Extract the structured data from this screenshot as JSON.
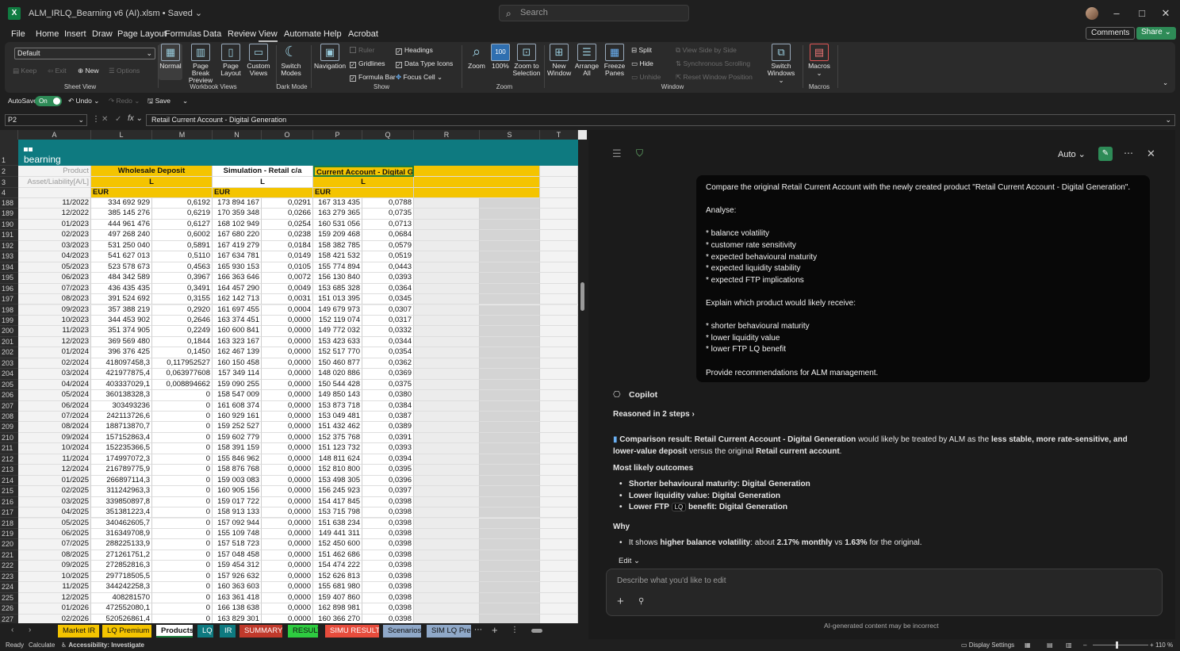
{
  "title_bar": {
    "file_title": "ALM_IRLQ_Bearning v6 (AI).xlsm  •  Saved ⌄",
    "search_placeholder": "Search",
    "app_icon_letter": "X"
  },
  "menu": {
    "items": [
      "File",
      "Home",
      "Insert",
      "Draw",
      "Page Layout",
      "Formulas",
      "Data",
      "Review",
      "View",
      "Automate",
      "Help",
      "Acrobat"
    ],
    "active": "View",
    "comments_label": "Comments",
    "share_label": "Share ⌄"
  },
  "ribbon": {
    "sheet_view": {
      "dropdown": "Default",
      "keep": "Keep",
      "exit": "Exit",
      "new": "New",
      "options": "Options",
      "label": "Sheet View"
    },
    "workbook_views": {
      "normal": "Normal",
      "page_break": "Page Break Preview",
      "page_layout": "Page Layout",
      "custom": "Custom Views",
      "label": "Workbook Views"
    },
    "dark_mode": {
      "switch": "Switch Modes",
      "label": "Dark Mode"
    },
    "show": {
      "navigation": "Navigation",
      "ruler": "Ruler",
      "gridlines": "Gridlines",
      "formula_bar": "Formula Bar",
      "headings": "Headings",
      "data_type_icons": "Data Type Icons",
      "focus_cell": "Focus Cell",
      "label": "Show"
    },
    "zoom": {
      "zoom": "Zoom",
      "hundred": "100%",
      "zoom_sel": "Zoom to Selection",
      "label": "Zoom"
    },
    "window": {
      "new_window": "New Window",
      "arrange_all": "Arrange All",
      "freeze": "Freeze Panes",
      "split": "Split",
      "hide": "Hide",
      "unhide": "Unhide",
      "side_by_side": "View Side by Side",
      "sync_scroll": "Synchronous Scrolling",
      "reset_pos": "Reset Window Position",
      "switch_windows": "Switch Windows",
      "label": "Window"
    },
    "macros": {
      "macros": "Macros",
      "label": "Macros"
    }
  },
  "qat": {
    "autosave": "AutoSave",
    "toggle": "On",
    "undo": "Undo",
    "redo": "Redo",
    "save": "Save"
  },
  "formula_bar": {
    "name_box": "P2",
    "formula": "Retail Current Account - Digital Generation"
  },
  "grid": {
    "columns": [
      "A",
      "L",
      "M",
      "N",
      "O",
      "P",
      "Q",
      "R",
      "S",
      "T"
    ],
    "logo_text": "bearning",
    "row_label_product": "Product",
    "row_label_al": "Asset/Liability[A/L]",
    "header_wholesale": "Wholesale Deposit",
    "header_sim_retail": "Simulation - Retail c/a",
    "header_current_account": "Current Account - Digital Gen",
    "l_label": "L",
    "eur_label": "EUR",
    "row_numbers_top": [
      "1",
      "2",
      "3",
      "4"
    ],
    "rows": [
      {
        "n": "188",
        "a": "11/2022",
        "l": "334 692 929",
        "m": "0,6192",
        "n2": "173 894 167",
        "o": "0,0291",
        "p": "167 313 435",
        "q": "0,0788"
      },
      {
        "n": "189",
        "a": "12/2022",
        "l": "385 145 276",
        "m": "0,6219",
        "n2": "170 359 348",
        "o": "0,0266",
        "p": "163 279 365",
        "q": "0,0735"
      },
      {
        "n": "190",
        "a": "01/2023",
        "l": "444 961 476",
        "m": "0,6127",
        "n2": "168 102 949",
        "o": "0,0254",
        "p": "160 531 056",
        "q": "0,0713"
      },
      {
        "n": "191",
        "a": "02/2023",
        "l": "497 268 240",
        "m": "0,6002",
        "n2": "167 680 220",
        "o": "0,0238",
        "p": "159 209 468",
        "q": "0,0684"
      },
      {
        "n": "192",
        "a": "03/2023",
        "l": "531 250 040",
        "m": "0,5891",
        "n2": "167 419 279",
        "o": "0,0184",
        "p": "158 382 785",
        "q": "0,0579"
      },
      {
        "n": "193",
        "a": "04/2023",
        "l": "541 627 013",
        "m": "0,5110",
        "n2": "167 634 781",
        "o": "0,0149",
        "p": "158 421 532",
        "q": "0,0519"
      },
      {
        "n": "194",
        "a": "05/2023",
        "l": "523 578 673",
        "m": "0,4563",
        "n2": "165 930 153",
        "o": "0,0105",
        "p": "155 774 894",
        "q": "0,0443"
      },
      {
        "n": "195",
        "a": "06/2023",
        "l": "484 342 589",
        "m": "0,3967",
        "n2": "166 363 646",
        "o": "0,0072",
        "p": "156 130 840",
        "q": "0,0393"
      },
      {
        "n": "196",
        "a": "07/2023",
        "l": "436 435 435",
        "m": "0,3491",
        "n2": "164 457 290",
        "o": "0,0049",
        "p": "153 685 328",
        "q": "0,0364"
      },
      {
        "n": "197",
        "a": "08/2023",
        "l": "391 524 692",
        "m": "0,3155",
        "n2": "162 142 713",
        "o": "0,0031",
        "p": "151 013 395",
        "q": "0,0345"
      },
      {
        "n": "198",
        "a": "09/2023",
        "l": "357 388 219",
        "m": "0,2920",
        "n2": "161 697 455",
        "o": "0,0004",
        "p": "149 679 973",
        "q": "0,0307"
      },
      {
        "n": "199",
        "a": "10/2023",
        "l": "344 453 902",
        "m": "0,2646",
        "n2": "163 374 451",
        "o": "0,0000",
        "p": "152 119 074",
        "q": "0,0317"
      },
      {
        "n": "200",
        "a": "11/2023",
        "l": "351 374 905",
        "m": "0,2249",
        "n2": "160 600 841",
        "o": "0,0000",
        "p": "149 772 032",
        "q": "0,0332"
      },
      {
        "n": "201",
        "a": "12/2023",
        "l": "369 569 480",
        "m": "0,1844",
        "n2": "163 323 167",
        "o": "0,0000",
        "p": "153 423 633",
        "q": "0,0344"
      },
      {
        "n": "202",
        "a": "01/2024",
        "l": "396 376 425",
        "m": "0,1450",
        "n2": "162 467 139",
        "o": "0,0000",
        "p": "152 517 770",
        "q": "0,0354"
      },
      {
        "n": "203",
        "a": "02/2024",
        "l": "418097458,3",
        "m": "0,117952527",
        "n2": "160 150 458",
        "o": "0,0000",
        "p": "150 460 877",
        "q": "0,0362"
      },
      {
        "n": "204",
        "a": "03/2024",
        "l": "421977875,4",
        "m": "0,063977608",
        "n2": "157 349 114",
        "o": "0,0000",
        "p": "148 020 886",
        "q": "0,0369"
      },
      {
        "n": "205",
        "a": "04/2024",
        "l": "403337029,1",
        "m": "0,008894662",
        "n2": "159 090 255",
        "o": "0,0000",
        "p": "150 544 428",
        "q": "0,0375"
      },
      {
        "n": "206",
        "a": "05/2024",
        "l": "360138328,3",
        "m": "0",
        "n2": "158 547 009",
        "o": "0,0000",
        "p": "149 850 143",
        "q": "0,0380"
      },
      {
        "n": "207",
        "a": "06/2024",
        "l": "303493236",
        "m": "0",
        "n2": "161 608 374",
        "o": "0,0000",
        "p": "153 873 718",
        "q": "0,0384"
      },
      {
        "n": "208",
        "a": "07/2024",
        "l": "242113726,6",
        "m": "0",
        "n2": "160 929 161",
        "o": "0,0000",
        "p": "153 049 481",
        "q": "0,0387"
      },
      {
        "n": "209",
        "a": "08/2024",
        "l": "188713870,7",
        "m": "0",
        "n2": "159 252 527",
        "o": "0,0000",
        "p": "151 432 462",
        "q": "0,0389"
      },
      {
        "n": "210",
        "a": "09/2024",
        "l": "157152863,4",
        "m": "0",
        "n2": "159 602 779",
        "o": "0,0000",
        "p": "152 375 768",
        "q": "0,0391"
      },
      {
        "n": "211",
        "a": "10/2024",
        "l": "152235366,5",
        "m": "0",
        "n2": "158 391 159",
        "o": "0,0000",
        "p": "151 123 732",
        "q": "0,0393"
      },
      {
        "n": "212",
        "a": "11/2024",
        "l": "174997072,3",
        "m": "0",
        "n2": "155 846 962",
        "o": "0,0000",
        "p": "148 811 624",
        "q": "0,0394"
      },
      {
        "n": "213",
        "a": "12/2024",
        "l": "216789775,9",
        "m": "0",
        "n2": "158 876 768",
        "o": "0,0000",
        "p": "152 810 800",
        "q": "0,0395"
      },
      {
        "n": "214",
        "a": "01/2025",
        "l": "266897114,3",
        "m": "0",
        "n2": "159 003 083",
        "o": "0,0000",
        "p": "153 498 305",
        "q": "0,0396"
      },
      {
        "n": "215",
        "a": "02/2025",
        "l": "311242963,3",
        "m": "0",
        "n2": "160 905 156",
        "o": "0,0000",
        "p": "156 245 923",
        "q": "0,0397"
      },
      {
        "n": "216",
        "a": "03/2025",
        "l": "339850897,8",
        "m": "0",
        "n2": "159 017 722",
        "o": "0,0000",
        "p": "154 417 845",
        "q": "0,0398"
      },
      {
        "n": "217",
        "a": "04/2025",
        "l": "351381223,4",
        "m": "0",
        "n2": "158 913 133",
        "o": "0,0000",
        "p": "153 715 798",
        "q": "0,0398"
      },
      {
        "n": "218",
        "a": "05/2025",
        "l": "340462605,7",
        "m": "0",
        "n2": "157 092 944",
        "o": "0,0000",
        "p": "151 638 234",
        "q": "0,0398"
      },
      {
        "n": "219",
        "a": "06/2025",
        "l": "316349708,9",
        "m": "0",
        "n2": "155 109 748",
        "o": "0,0000",
        "p": "149 441 311",
        "q": "0,0398"
      },
      {
        "n": "220",
        "a": "07/2025",
        "l": "288225133,9",
        "m": "0",
        "n2": "157 518 723",
        "o": "0,0000",
        "p": "152 450 600",
        "q": "0,0398"
      },
      {
        "n": "221",
        "a": "08/2025",
        "l": "271261751,2",
        "m": "0",
        "n2": "157 048 458",
        "o": "0,0000",
        "p": "151 462 686",
        "q": "0,0398"
      },
      {
        "n": "222",
        "a": "09/2025",
        "l": "272852816,3",
        "m": "0",
        "n2": "159 454 312",
        "o": "0,0000",
        "p": "154 474 222",
        "q": "0,0398"
      },
      {
        "n": "223",
        "a": "10/2025",
        "l": "297718505,5",
        "m": "0",
        "n2": "157 926 632",
        "o": "0,0000",
        "p": "152 626 813",
        "q": "0,0398"
      },
      {
        "n": "224",
        "a": "11/2025",
        "l": "344242258,3",
        "m": "0",
        "n2": "160 363 603",
        "o": "0,0000",
        "p": "155 681 980",
        "q": "0,0398"
      },
      {
        "n": "225",
        "a": "12/2025",
        "l": "408281570",
        "m": "0",
        "n2": "163 361 418",
        "o": "0,0000",
        "p": "159 407 860",
        "q": "0,0398"
      },
      {
        "n": "226",
        "a": "01/2026",
        "l": "472552080,1",
        "m": "0",
        "n2": "166 138 638",
        "o": "0,0000",
        "p": "162 898 981",
        "q": "0,0398"
      },
      {
        "n": "227",
        "a": "02/2026",
        "l": "520526861,4",
        "m": "0",
        "n2": "163 829 301",
        "o": "0,0000",
        "p": "160 366 270",
        "q": "0,0398"
      }
    ]
  },
  "sheet_tabs": [
    {
      "label": "Market IR",
      "color": "#f4c400"
    },
    {
      "label": "LQ Premium",
      "color": "#f4c400"
    },
    {
      "label": "Products",
      "color": "#f4c400",
      "active": true
    },
    {
      "label": "LQ",
      "color": "#0e7a80"
    },
    {
      "label": "IR",
      "color": "#0e7a80"
    },
    {
      "label": "SUMMARY",
      "color": "#c0392b"
    },
    {
      "label": "RESULT",
      "color": "#2ecc40"
    },
    {
      "label": "SIMU RESULT",
      "color": "#e74c3c"
    },
    {
      "label": "Scenarios",
      "color": "#8fa8c8"
    },
    {
      "label": "SIM LQ Prem",
      "color": "#8fa8c8"
    }
  ],
  "status": {
    "ready": "Ready",
    "calc": "Calculate",
    "accessibility": "Accessibility: Investigate",
    "display": "Display Settings",
    "zoom": "110 %"
  },
  "copilot": {
    "auto_label": "Auto ⌄",
    "prompt_lines": [
      "Compare the original Retail Current Account with the newly created product \"Retail Current Account - Digital Generation\".",
      "",
      "Analyse:",
      "",
      "* balance volatility",
      "* customer rate sensitivity",
      "* expected behavioural maturity",
      "* expected liquidity stability",
      "* expected FTP implications",
      "",
      "Explain which product would likely receive:",
      "",
      "* shorter behavioural maturity",
      "* lower liquidity value",
      "* lower FTP LQ benefit",
      "",
      "Provide recommendations for ALM management."
    ],
    "copilot_label": "Copilot",
    "reasoned": "Reasoned in 2 steps",
    "result_prefix": "Comparison result: Retail Current Account - Digital Generation",
    "result_mid": " would likely be treated by ALM as the ",
    "result_bold2": "less stable, more rate-sensitive, and lower-value deposit",
    "result_mid2": " versus the original ",
    "result_bold3": "Retail current account",
    "result_end": ".",
    "most_likely": "Most likely outcomes",
    "outcome1": "Shorter behavioural maturity: Digital Generation",
    "outcome2": "Lower liquidity value: Digital Generation",
    "outcome3_a": "Lower FTP ",
    "outcome3_badge": "LQ",
    "outcome3_b": " benefit: Digital Generation",
    "why": "Why",
    "why1_a": "It shows ",
    "why1_b": "higher balance volatility",
    "why1_c": ": about ",
    "why1_d": "2.17% monthly",
    "why1_e": " vs ",
    "why1_f": "1.63%",
    "why1_g": " for the original.",
    "edit_label": "Edit ⌄",
    "input_placeholder": "Describe what you'd like to edit",
    "disclaimer": "AI-generated content may be incorrect"
  }
}
